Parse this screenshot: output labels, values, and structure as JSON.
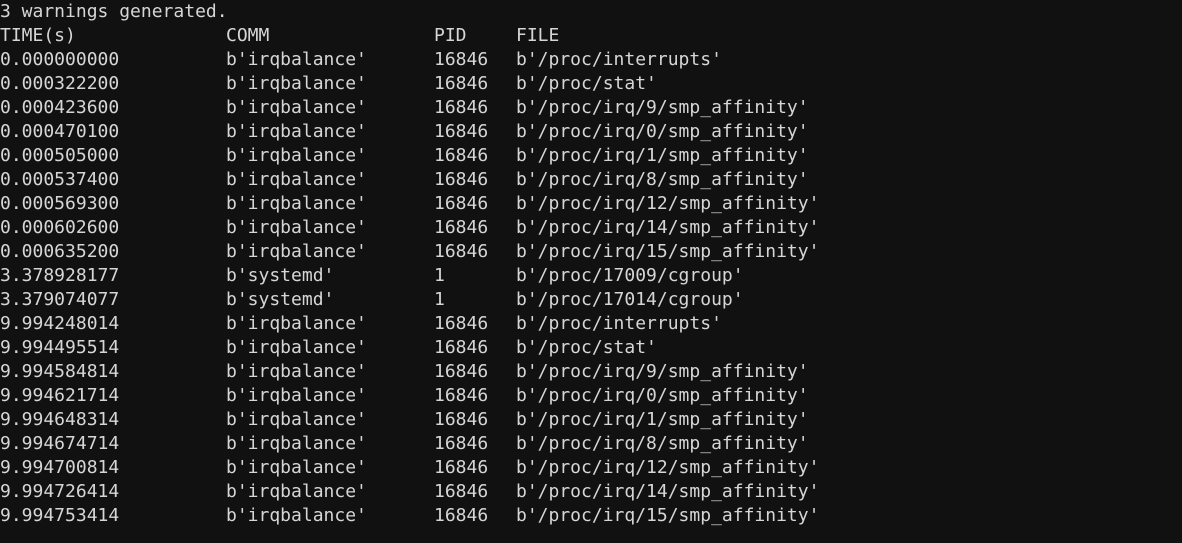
{
  "terminal": {
    "background_color": "#111111",
    "text_color": "#d6d6d6",
    "preamble": "3 warnings generated.",
    "columns": {
      "time": "TIME(s)",
      "comm": "COMM",
      "pid": "PID",
      "file": "FILE"
    },
    "rows": [
      {
        "time": "0.000000000",
        "comm": "b'irqbalance'",
        "pid": "16846",
        "file": "b'/proc/interrupts'"
      },
      {
        "time": "0.000322200",
        "comm": "b'irqbalance'",
        "pid": "16846",
        "file": "b'/proc/stat'"
      },
      {
        "time": "0.000423600",
        "comm": "b'irqbalance'",
        "pid": "16846",
        "file": "b'/proc/irq/9/smp_affinity'"
      },
      {
        "time": "0.000470100",
        "comm": "b'irqbalance'",
        "pid": "16846",
        "file": "b'/proc/irq/0/smp_affinity'"
      },
      {
        "time": "0.000505000",
        "comm": "b'irqbalance'",
        "pid": "16846",
        "file": "b'/proc/irq/1/smp_affinity'"
      },
      {
        "time": "0.000537400",
        "comm": "b'irqbalance'",
        "pid": "16846",
        "file": "b'/proc/irq/8/smp_affinity'"
      },
      {
        "time": "0.000569300",
        "comm": "b'irqbalance'",
        "pid": "16846",
        "file": "b'/proc/irq/12/smp_affinity'"
      },
      {
        "time": "0.000602600",
        "comm": "b'irqbalance'",
        "pid": "16846",
        "file": "b'/proc/irq/14/smp_affinity'"
      },
      {
        "time": "0.000635200",
        "comm": "b'irqbalance'",
        "pid": "16846",
        "file": "b'/proc/irq/15/smp_affinity'"
      },
      {
        "time": "3.378928177",
        "comm": "b'systemd'",
        "pid": "1",
        "file": "b'/proc/17009/cgroup'"
      },
      {
        "time": "3.379074077",
        "comm": "b'systemd'",
        "pid": "1",
        "file": "b'/proc/17014/cgroup'"
      },
      {
        "time": "9.994248014",
        "comm": "b'irqbalance'",
        "pid": "16846",
        "file": "b'/proc/interrupts'"
      },
      {
        "time": "9.994495514",
        "comm": "b'irqbalance'",
        "pid": "16846",
        "file": "b'/proc/stat'"
      },
      {
        "time": "9.994584814",
        "comm": "b'irqbalance'",
        "pid": "16846",
        "file": "b'/proc/irq/9/smp_affinity'"
      },
      {
        "time": "9.994621714",
        "comm": "b'irqbalance'",
        "pid": "16846",
        "file": "b'/proc/irq/0/smp_affinity'"
      },
      {
        "time": "9.994648314",
        "comm": "b'irqbalance'",
        "pid": "16846",
        "file": "b'/proc/irq/1/smp_affinity'"
      },
      {
        "time": "9.994674714",
        "comm": "b'irqbalance'",
        "pid": "16846",
        "file": "b'/proc/irq/8/smp_affinity'"
      },
      {
        "time": "9.994700814",
        "comm": "b'irqbalance'",
        "pid": "16846",
        "file": "b'/proc/irq/12/smp_affinity'"
      },
      {
        "time": "9.994726414",
        "comm": "b'irqbalance'",
        "pid": "16846",
        "file": "b'/proc/irq/14/smp_affinity'"
      },
      {
        "time": "9.994753414",
        "comm": "b'irqbalance'",
        "pid": "16846",
        "file": "b'/proc/irq/15/smp_affinity'"
      }
    ]
  }
}
